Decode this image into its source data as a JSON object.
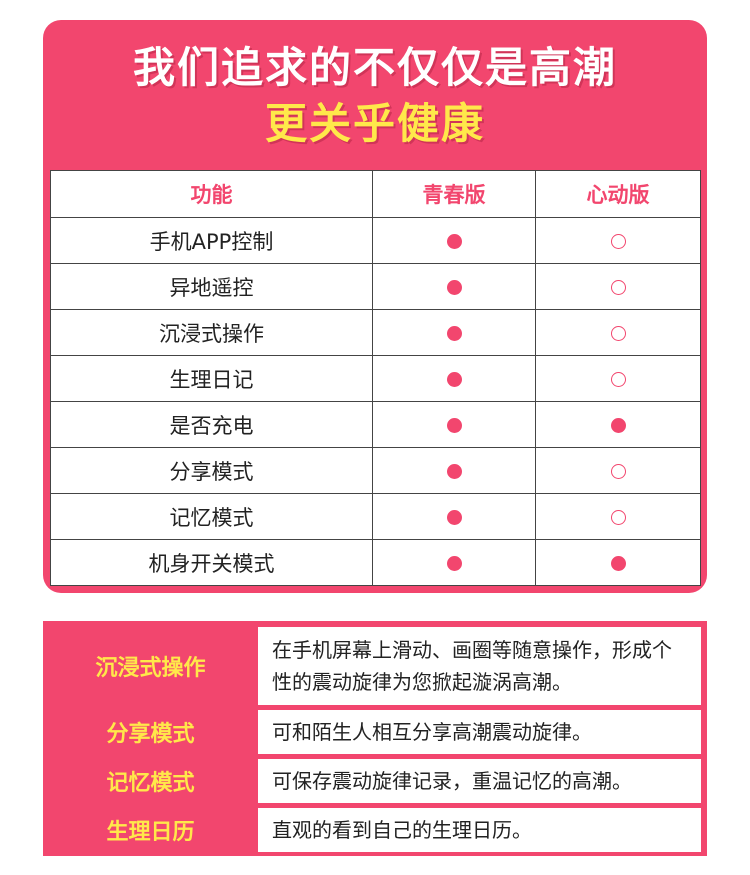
{
  "header": {
    "line1": "我们追求的不仅仅是高潮",
    "line2": "更关乎健康"
  },
  "colors": {
    "primary": "#f2466e",
    "highlight": "#ffe84a"
  },
  "comparison": {
    "columns": [
      "功能",
      "青春版",
      "心动版"
    ],
    "rows": [
      {
        "feature": "手机APP控制",
        "youth": "filled",
        "heart": "empty"
      },
      {
        "feature": "异地遥控",
        "youth": "filled",
        "heart": "empty"
      },
      {
        "feature": "沉浸式操作",
        "youth": "filled",
        "heart": "empty"
      },
      {
        "feature": "生理日记",
        "youth": "filled",
        "heart": "empty"
      },
      {
        "feature": "是否充电",
        "youth": "filled",
        "heart": "filled"
      },
      {
        "feature": "分享模式",
        "youth": "filled",
        "heart": "empty"
      },
      {
        "feature": "记忆模式",
        "youth": "filled",
        "heart": "empty"
      },
      {
        "feature": "机身开关模式",
        "youth": "filled",
        "heart": "filled"
      }
    ]
  },
  "descriptions": [
    {
      "label": "沉浸式操作",
      "text": "在手机屏幕上滑动、画圈等随意操作，形成个性的震动旋律为您掀起漩涡高潮。"
    },
    {
      "label": "分享模式",
      "text": "可和陌生人相互分享高潮震动旋律。"
    },
    {
      "label": "记忆模式",
      "text": "可保存震动旋律记录，重温记忆的高潮。"
    },
    {
      "label": "生理日历",
      "text": "直观的看到自己的生理日历。"
    }
  ]
}
